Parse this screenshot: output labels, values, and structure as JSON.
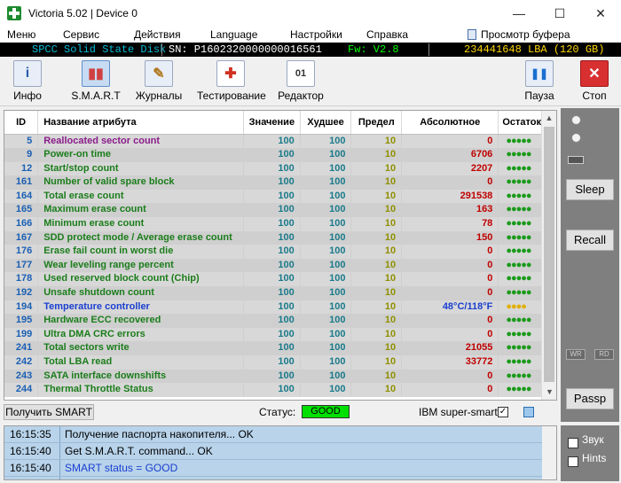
{
  "window": {
    "title": "Victoria 5.02 | Device 0",
    "controls": [
      "—",
      "☐",
      "✕"
    ]
  },
  "menu": {
    "items": [
      "Меню",
      "Сервис",
      "Действия",
      "Language",
      "Настройки",
      "Справка"
    ],
    "clipboard_view": "Просмотр буфера"
  },
  "infobar": {
    "disk": "SPCC Solid State Disk",
    "serial": "SN: P1602320000000016561",
    "firmware": "Fw: V2.8",
    "capacity": "234441648 LBA (120 GB)"
  },
  "toolbar": {
    "left": [
      {
        "label": "Инфо",
        "icon": "i"
      },
      {
        "label": "S.M.A.R.T",
        "icon": "▮▮"
      },
      {
        "label": "Журналы",
        "icon": "✎"
      },
      {
        "label": "Тестирование",
        "icon": "✚"
      },
      {
        "label": "Редактор",
        "icon": "01"
      }
    ],
    "right": [
      {
        "label": "Пауза",
        "icon": "❚❚"
      },
      {
        "label": "Стоп",
        "icon": "✕"
      }
    ]
  },
  "table": {
    "columns": [
      "ID",
      "Название атрибута",
      "Значение",
      "Худшее",
      "Предел",
      "Абсолютное",
      "Остаток"
    ],
    "rows": [
      {
        "id": "5",
        "name": "Reallocated sector count",
        "value": "100",
        "worst": "100",
        "threshold": "10",
        "raw": "0",
        "health": "●●●●●",
        "name_color": "#8b1c8b"
      },
      {
        "id": "9",
        "name": "Power-on time",
        "value": "100",
        "worst": "100",
        "threshold": "10",
        "raw": "6706",
        "health": "●●●●●"
      },
      {
        "id": "12",
        "name": "Start/stop count",
        "value": "100",
        "worst": "100",
        "threshold": "10",
        "raw": "2207",
        "health": "●●●●●"
      },
      {
        "id": "161",
        "name": "Number of valid spare block",
        "value": "100",
        "worst": "100",
        "threshold": "10",
        "raw": "0",
        "health": "●●●●●"
      },
      {
        "id": "164",
        "name": "Total erase count",
        "value": "100",
        "worst": "100",
        "threshold": "10",
        "raw": "291538",
        "health": "●●●●●"
      },
      {
        "id": "165",
        "name": "Maximum erase count",
        "value": "100",
        "worst": "100",
        "threshold": "10",
        "raw": "163",
        "health": "●●●●●"
      },
      {
        "id": "166",
        "name": "Minimum erase count",
        "value": "100",
        "worst": "100",
        "threshold": "10",
        "raw": "78",
        "health": "●●●●●"
      },
      {
        "id": "167",
        "name": "SDD protect mode / Average erase count",
        "value": "100",
        "worst": "100",
        "threshold": "10",
        "raw": "150",
        "health": "●●●●●"
      },
      {
        "id": "176",
        "name": "Erase fail count in worst die",
        "value": "100",
        "worst": "100",
        "threshold": "10",
        "raw": "0",
        "health": "●●●●●"
      },
      {
        "id": "177",
        "name": "Wear leveling range percent",
        "value": "100",
        "worst": "100",
        "threshold": "10",
        "raw": "0",
        "health": "●●●●●"
      },
      {
        "id": "178",
        "name": "Used reserved block count (Chip)",
        "value": "100",
        "worst": "100",
        "threshold": "10",
        "raw": "0",
        "health": "●●●●●"
      },
      {
        "id": "192",
        "name": "Unsafe shutdown count",
        "value": "100",
        "worst": "100",
        "threshold": "10",
        "raw": "0",
        "health": "●●●●●"
      },
      {
        "id": "194",
        "name": "Temperature controller",
        "value": "100",
        "worst": "100",
        "threshold": "10",
        "raw": "48°C/118°F",
        "health": "●●●●",
        "name_color": "#1a3fd0",
        "raw_color": "#1a3fd0",
        "health_color": "#e0b000"
      },
      {
        "id": "195",
        "name": "Hardware ECC recovered",
        "value": "100",
        "worst": "100",
        "threshold": "10",
        "raw": "0",
        "health": "●●●●●"
      },
      {
        "id": "199",
        "name": "Ultra DMA CRC errors",
        "value": "100",
        "worst": "100",
        "threshold": "10",
        "raw": "0",
        "health": "●●●●●"
      },
      {
        "id": "241",
        "name": "Total sectors write",
        "value": "100",
        "worst": "100",
        "threshold": "10",
        "raw": "21055",
        "health": "●●●●●"
      },
      {
        "id": "242",
        "name": "Total LBA read",
        "value": "100",
        "worst": "100",
        "threshold": "10",
        "raw": "33772",
        "health": "●●●●●"
      },
      {
        "id": "243",
        "name": "SATA interface downshifts",
        "value": "100",
        "worst": "100",
        "threshold": "10",
        "raw": "0",
        "health": "●●●●●"
      },
      {
        "id": "244",
        "name": "Thermal Throttle Status",
        "value": "100",
        "worst": "100",
        "threshold": "10",
        "raw": "0",
        "health": "●●●●●"
      }
    ]
  },
  "status": {
    "get_smart_button": "Получить SMART",
    "label": "Статус:",
    "value": "GOOD",
    "ibm_label": "IBM super-smart:",
    "ibm_checked": "✓"
  },
  "log": [
    {
      "time": "16:15:35",
      "message": "Получение паспорта накопителя... OK"
    },
    {
      "time": "16:15:40",
      "message": "Get S.M.A.R.T. command... OK"
    },
    {
      "time": "16:15:40",
      "message": "SMART status = GOOD",
      "color": "#1a3fd0"
    }
  ],
  "sidebar": {
    "sleep": "Sleep",
    "recall": "Recall",
    "passp": "Passp",
    "wr": "WR",
    "rd": "RD"
  },
  "options": {
    "sound": "Звук",
    "hints": "Hints",
    "sound_checked": "✓",
    "hints_checked": "✓"
  },
  "colors": {
    "good": "#00e000",
    "log_bg": "#b8d3ea",
    "info_disk": "#00bcd4",
    "info_sn": "#ffffff",
    "info_fw": "#00ff00",
    "info_cap": "#ffd700"
  }
}
